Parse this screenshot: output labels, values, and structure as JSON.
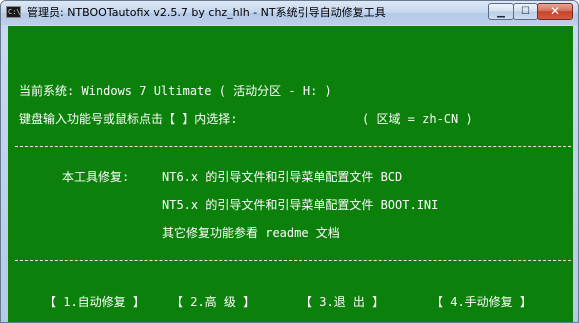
{
  "window": {
    "title": "管理员: NTBOOTautofix v2.5.7 by chz_hlh - NT系统引导自动修复工具",
    "icon_label": "C:\\",
    "controls": {
      "minimize": "▁",
      "maximize": "☐",
      "close": "✕"
    }
  },
  "console": {
    "system_line": "当前系统: Windows 7 Ultimate  ( 活动分区 - H: )",
    "input_prompt": "键盘输入功能号或鼠标点击【 】内选择:",
    "region": "( 区域 = zh-CN )",
    "separator": "----------------------------------------------------------------------------------",
    "repair_label": "本工具修复:",
    "repair_items": [
      "NT6.x 的引导文件和引导菜单配置文件 BCD",
      "NT5.x 的引导文件和引导菜单配置文件 BOOT.INI",
      "其它修复功能参看 readme 文档"
    ],
    "menu": [
      "【 1.自动修复 】",
      "【 2.高  级 】",
      "【 3.退  出 】",
      "【 4.手动修复 】"
    ]
  }
}
